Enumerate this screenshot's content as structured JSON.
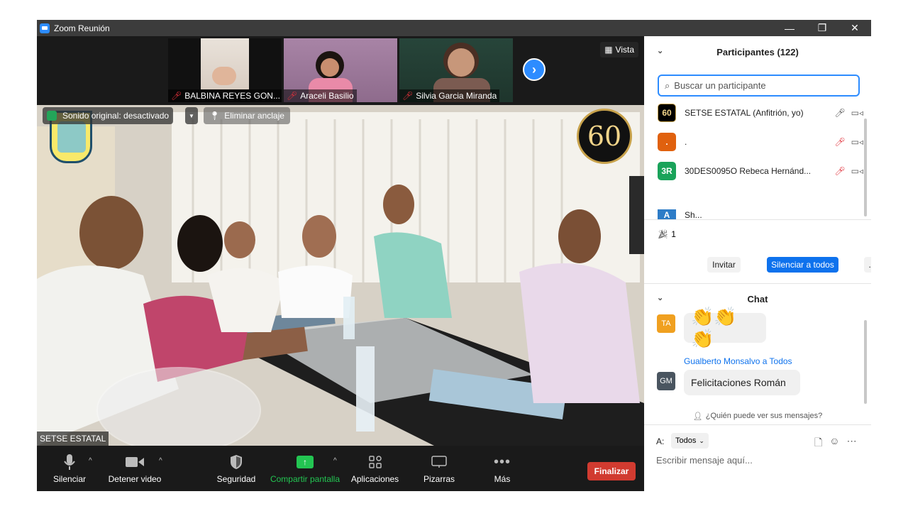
{
  "window": {
    "title": "Zoom Reunión",
    "controls": [
      "—",
      "❐",
      "✕"
    ]
  },
  "gallery": {
    "thumbnails": [
      {
        "name": "BALBINA REYES GON..."
      },
      {
        "name": "Araceli Basilio"
      },
      {
        "name": "Silvia Garcia Miranda"
      }
    ],
    "view_label": "Vista"
  },
  "main_video": {
    "original_sound": "Sonido original: desactivado",
    "unpin": "Eliminar anclaje",
    "speaker_name": "SETSE ESTATAL",
    "logo_number": "60"
  },
  "toolbar": {
    "mute": "Silenciar",
    "stop_video": "Detener video",
    "security": "Seguridad",
    "share_screen": "Compartir pantalla",
    "apps": "Aplicaciones",
    "whiteboards": "Pizarras",
    "more": "Más",
    "end": "Finalizar"
  },
  "participants": {
    "header": "Participantes (122)",
    "search_placeholder": "Buscar un participante",
    "list": [
      {
        "avatar": "60",
        "name": "SETSE ESTATAL (Anfitrión, yo)",
        "color": "#000000"
      },
      {
        "avatar": ".",
        "name": ".",
        "color": "#e0610e"
      },
      {
        "avatar": "3R",
        "name": "30DES0095O  Rebeca Hernánd...",
        "color": "#1aa35a"
      },
      {
        "avatar": "A",
        "name": "Sh...",
        "color": "#2d7cc7"
      }
    ],
    "reactions_count": "1",
    "invite": "Invitar",
    "mute_all": "Silenciar a todos",
    "more": "..."
  },
  "chat": {
    "header": "Chat",
    "messages": [
      {
        "avatar": "TA",
        "avatar_color": "#f0a020",
        "text": "👏👏👏"
      },
      {
        "sender": "Gualberto Monsalvo a Todos",
        "avatar": "GM",
        "avatar_color": "#4a5560",
        "text": "Felicitaciones Román"
      }
    ],
    "who_can_see": "¿Quién puede ver sus mensajes?",
    "to_label": "A:",
    "to_value": "Todos",
    "input_placeholder": "Escribir mensaje aquí..."
  }
}
